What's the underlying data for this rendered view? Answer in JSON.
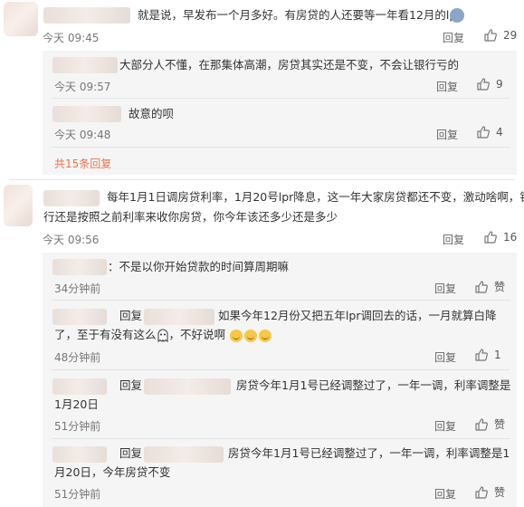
{
  "thread1": {
    "text": "就是说，早发布一个月多好。有房贷的人还要等一年看12月的lpr",
    "time": "今天 09:45",
    "reply_label": "回复",
    "likes": "29",
    "replies": [
      {
        "text": "大部分人不懂，在那集体高潮，房贷其实还是不变，不会让银行亏的",
        "time": "今天 09:57",
        "reply_label": "回复",
        "likes": "9"
      },
      {
        "text": "故意的呗",
        "time": "今天 09:48",
        "reply_label": "回复",
        "likes": "4"
      }
    ],
    "more_replies": "共15条回复"
  },
  "thread2": {
    "text_line1": "每年1月1日调房贷利率，1月20号lpr降息，这一年大家房贷都还不变，激动啥啊，银",
    "text_line2": "行还是按照之前利率来收你房贷，你今年该还多少还是多少",
    "time": "今天 09:56",
    "reply_label": "回复",
    "likes": "16",
    "replies": [
      {
        "text": "：不是以你开始贷款的时间算周期嘛",
        "time": "34分钟前",
        "reply_label": "回复",
        "likes": "赞"
      },
      {
        "prefix": "回复",
        "text_line1": "如果今年12月份又把五年lpr调回去的话，一月就算白降",
        "text_line2a": "了，至于有没有这么",
        "text_line2b": "，不好说啊",
        "time": "48分钟前",
        "reply_label": "回复",
        "likes": "1"
      },
      {
        "prefix": "回复",
        "text_line1": "房贷今年1月1号已经调整过了，一年一调，利率调整是",
        "text_line2": "1月20日",
        "time": "51分钟前",
        "reply_label": "回复",
        "likes": "赞"
      },
      {
        "prefix": "回复",
        "text_line1": "房贷今年1月1号已经调整过了，一年一调，利率调整是1",
        "text_line2": "月20日，今年房贷不变",
        "time": "51分钟前",
        "reply_label": "回复",
        "likes": "赞"
      }
    ]
  },
  "colors": {
    "accent": "#eb7350",
    "reply_bg": "#f5f5f5"
  }
}
